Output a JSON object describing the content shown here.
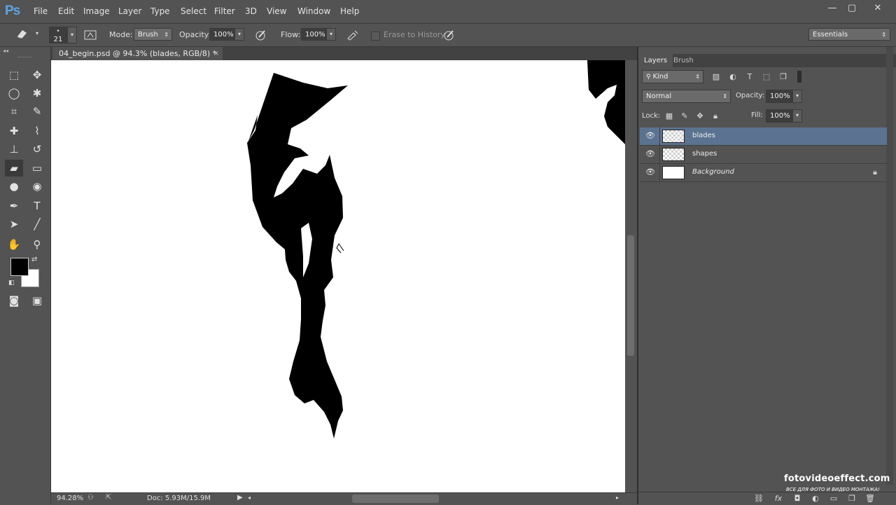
{
  "app": {
    "logo": "Ps"
  },
  "menu": [
    "File",
    "Edit",
    "Image",
    "Layer",
    "Type",
    "Select",
    "Filter",
    "3D",
    "View",
    "Window",
    "Help"
  ],
  "window_controls": {
    "minimize": "—",
    "maximize": "▢",
    "close": "✕"
  },
  "options": {
    "brush_size": "21",
    "mode_label": "Mode:",
    "mode_value": "Brush",
    "opacity_label": "Opacity:",
    "opacity_value": "100%",
    "flow_label": "Flow:",
    "flow_value": "100%",
    "erase_history_label": "Erase to History",
    "workspace": "Essentials"
  },
  "document": {
    "tab_title": "04_begin.psd @ 94.3% (blades, RGB/8) *",
    "tab_close": "×"
  },
  "status": {
    "zoom": "94.28%",
    "doc_size": "Doc: 5.93M/15.9M"
  },
  "layers_panel": {
    "tabs": [
      "Layers",
      "Brush"
    ],
    "filter_kind": "Kind",
    "blend_mode": "Normal",
    "opacity_label": "Opacity:",
    "opacity_value": "100%",
    "lock_label": "Lock:",
    "fill_label": "Fill:",
    "fill_value": "100%",
    "layers": [
      {
        "name": "blades",
        "selected": true
      },
      {
        "name": "shapes",
        "selected": false
      },
      {
        "name": "Background",
        "selected": false,
        "locked": true
      }
    ]
  },
  "watermark": {
    "main": "fotovideoeffect.com",
    "sub": "ВСЕ ДЛЯ ФОТО И ВИДЕО МОНТАЖА!"
  },
  "colors": {
    "foreground": "#000000",
    "background": "#ffffff",
    "selected_layer": "#5b7390",
    "ps_logo": "#5fa5e6"
  }
}
